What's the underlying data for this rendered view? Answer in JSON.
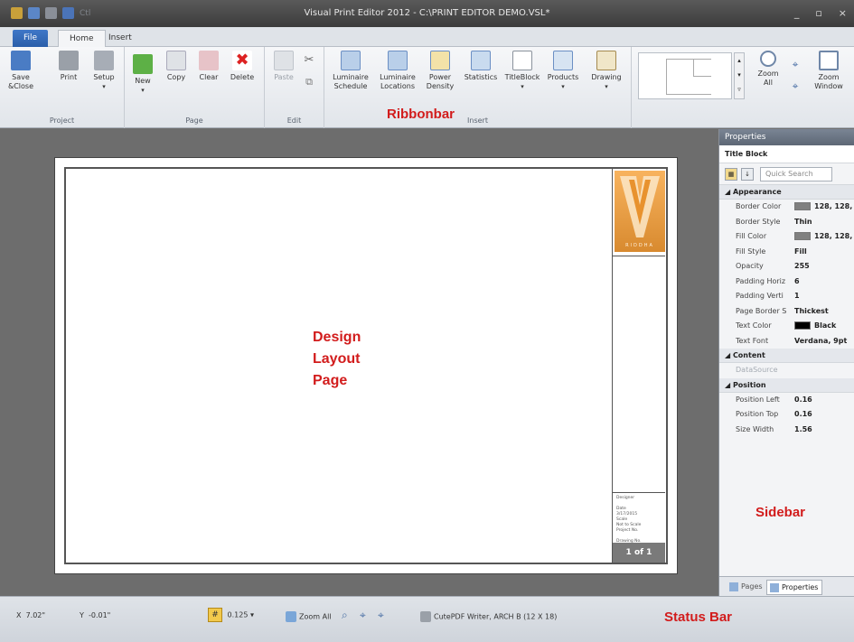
{
  "window": {
    "title": "Visual Print Editor 2012 - C:\\PRINT EDITOR DEMO.VSL*",
    "qat_ghost": "Ctl"
  },
  "tabs": [
    {
      "label": "File"
    },
    {
      "label": "Home"
    },
    {
      "label": "Insert"
    }
  ],
  "ribbon": {
    "groups": {
      "project": {
        "label": "Project",
        "buttons": [
          "Save &Close",
          "Print",
          "Setup"
        ]
      },
      "page": {
        "label": "Page",
        "buttons": [
          "New",
          "Copy",
          "Clear",
          "Delete"
        ]
      },
      "edit": {
        "label": "Edit",
        "buttons": [
          "Paste"
        ]
      },
      "insert": {
        "label": "Insert",
        "buttons": [
          "Luminaire Schedule",
          "Luminaire Locations",
          "Power Density",
          "Statistics",
          "TitleBlock",
          "Products",
          "Drawing"
        ]
      },
      "zoom": {
        "buttons": [
          "Zoom All",
          "Zoom Window"
        ]
      }
    }
  },
  "annotations": {
    "ribbonbar": "Ribbonbar",
    "design_line1": "Design",
    "design_line2": "Layout",
    "design_line3": "Page",
    "sidebar": "Sidebar",
    "statusbar": "Status Bar"
  },
  "titleblock": {
    "logo_word": "RIDDHA",
    "info_lines": [
      "Designer",
      "Date",
      "3/17/2015",
      "Scale",
      "Not to Scale",
      "Project No.",
      "Drawing No."
    ],
    "page_label": "1 of 1"
  },
  "sidebar": {
    "header": "Properties",
    "object": "Title Block",
    "search_placeholder": "Quick Search",
    "categories": {
      "appearance": "Appearance",
      "content": "Content",
      "position": "Position"
    },
    "appearance_props": [
      {
        "name": "Border Color",
        "value": "128, 128,",
        "swatch": "#808080"
      },
      {
        "name": "Border Style",
        "value": "Thin"
      },
      {
        "name": "Fill Color",
        "value": "128, 128,",
        "swatch": "#808080"
      },
      {
        "name": "Fill Style",
        "value": "Fill"
      },
      {
        "name": "Opacity",
        "value": "255"
      },
      {
        "name": "Padding Horiz",
        "value": "6"
      },
      {
        "name": "Padding Verti",
        "value": "1"
      },
      {
        "name": "Page Border S",
        "value": "Thickest"
      },
      {
        "name": "Text Color",
        "value": "Black",
        "swatch": "#000000"
      },
      {
        "name": "Text Font",
        "value": "Verdana, 9pt"
      }
    ],
    "content_props": [
      {
        "name": "DataSource",
        "value": ""
      }
    ],
    "position_props": [
      {
        "name": "Position Left",
        "value": "0.16"
      },
      {
        "name": "Position Top",
        "value": "0.16"
      },
      {
        "name": "Size Width",
        "value": "1.56"
      }
    ],
    "bottom_tabs": [
      "Pages",
      "Properties"
    ]
  },
  "statusbar": {
    "x_label": "X",
    "x_value": "7.02\"",
    "y_label": "Y",
    "y_value": "-0.01\"",
    "snap": "0.125",
    "zoom_all": "Zoom All",
    "printer": "CutePDF Writer, ARCH B (12 X 18)"
  },
  "colors": {
    "file_tab": "#2b5ea9",
    "annotation": "#d21c1c",
    "logo": "#e89a3c"
  }
}
